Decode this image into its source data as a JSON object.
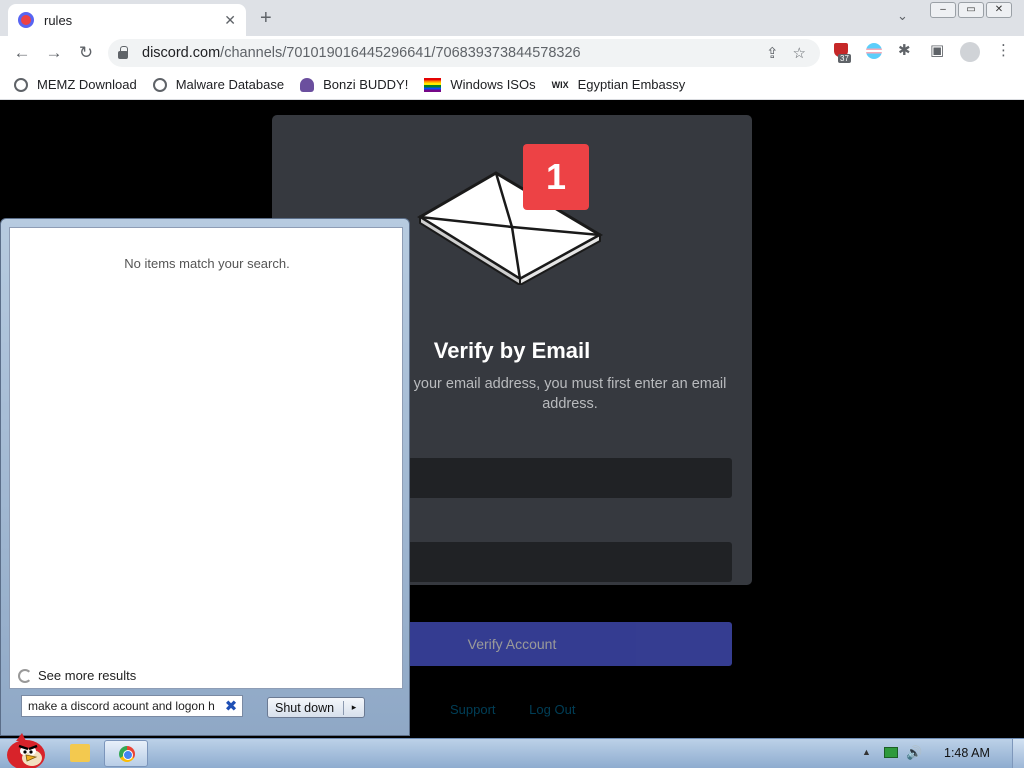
{
  "browser": {
    "tab_title": "rules",
    "tab_close": "✕",
    "new_tab": "+",
    "tab_search": "⌄",
    "window_controls": [
      "–",
      "▭",
      "✕"
    ],
    "nav": {
      "back": "←",
      "forward": "→",
      "reload": "↻"
    },
    "url_host": "discord.com",
    "url_path": "/channels/701019016445296641/706839373844578326",
    "extension_badge_count": "37",
    "menu": "⋮"
  },
  "bookmarks": [
    {
      "label": "MEMZ Download",
      "icon": "globe-icon"
    },
    {
      "label": "Malware Database",
      "icon": "globe-icon"
    },
    {
      "label": "Bonzi BUDDY!",
      "icon": "bonzi-icon"
    },
    {
      "label": "Windows ISOs",
      "icon": "rainbow-flag-icon"
    },
    {
      "label": "Egyptian Embassy",
      "icon": "wix-icon",
      "icon_text": "WIX"
    }
  ],
  "discord": {
    "notification_count": "1",
    "title": "Verify by Email",
    "description": "your email address, you must first enter an email address.",
    "verify_button": "Verify Account",
    "support_link": "Support",
    "logout_link": "Log Out",
    "accent_color": "#5865f2"
  },
  "start_menu": {
    "no_results": "No items match your search.",
    "see_more": "See more results",
    "search_value": "make a discord acount and logon h",
    "clear_icon": "✖",
    "shutdown_label": "Shut down",
    "shutdown_arrow": "▸"
  },
  "taskbar": {
    "tray_arrow": "▲",
    "volume_icon": "🔊",
    "clock": "1:48 AM"
  }
}
